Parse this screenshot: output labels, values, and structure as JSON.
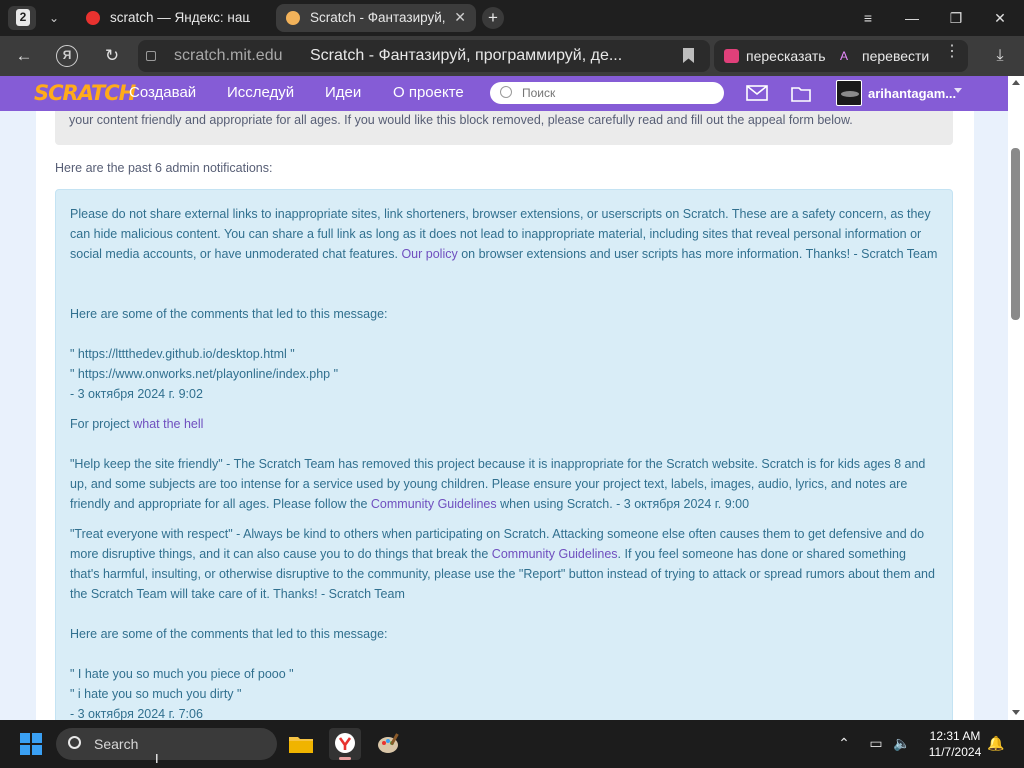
{
  "browser": {
    "tab_count": "2",
    "tabs": [
      {
        "title": "scratch — Яндекс: нашлось",
        "active": false
      },
      {
        "title": "Scratch - Фантазируй, п",
        "active": true
      }
    ],
    "address": {
      "domain": "scratch.mit.edu",
      "page_title": "Scratch - Фантазируй, программируй, де..."
    },
    "actions": {
      "retell": "пересказать",
      "translate": "перевести"
    }
  },
  "scratch_nav": {
    "logo": "SCRATCH",
    "links": [
      "Создавай",
      "Исследуй",
      "Идеи",
      "О проекте"
    ],
    "search_placeholder": "Поиск",
    "username": "arihantagam..."
  },
  "content": {
    "top_alert": "your content friendly and appropriate for all ages. If you would like this block removed, please carefully read and fill out the appeal form below.",
    "past_heading": "Here are the past 6 admin notifications:",
    "notification_1": {
      "t1": "Please do not share external links to inappropriate sites, link shorteners, browser extensions, or userscripts on Scratch. These are a safety concern, as they can hide malicious content. You can share a full link as long as it does not lead to inappropriate material, including sites that reveal personal information or social media accounts, or have unmoderated chat features.",
      "link_policy": "Our policy",
      "t2": "on browser extensions and user scripts has more information. Thanks! - Scratch Team",
      "comments_heading": "Here are some of the comments that led to this message:",
      "comments": [
        "\" https://lttthedev.github.io/desktop.html \"",
        "\" https://www.onworks.net/playonline/index.php \""
      ],
      "date": "- 3 октября 2024 г. 9:02"
    },
    "project_notice": {
      "prefix": "For project",
      "project_link": "what the hell"
    },
    "notification_2": {
      "t1": "\"Help keep the site friendly\" - The Scratch Team has removed this project because it is inappropriate for the Scratch website. Scratch is for kids ages 8 and up, and some subjects are too intense for a service used by young children. Please ensure your project text, labels, images, audio, lyrics, and notes are friendly and appropriate for all ages. Please follow the",
      "link_guidelines": "Community Guidelines",
      "t2": "when using Scratch. - 3 октября 2024 г. 9:00"
    },
    "notification_3": {
      "t1": "\"Treat everyone with respect\" - Always be kind to others when participating on Scratch. Attacking someone else often causes them to get defensive and do more disruptive things, and it can also cause you to do things that break the",
      "link_guidelines": "Community Guidelines",
      "t2": ". If you feel someone has done or shared something that's harmful, insulting, or otherwise disruptive to the community, please use the \"Report\" button instead of trying to attack or spread rumors about them and the Scratch Team will take care of it. Thanks! - Scratch Team",
      "comments_heading": "Here are some of the comments that led to this message:",
      "comments": [
        "\" I hate you so much you piece of pooo \"",
        "\" i hate you so much you dirty \""
      ],
      "date": "- 3 октября 2024 г. 7:06"
    }
  },
  "taskbar": {
    "search_label": "Search",
    "time": "12:31 AM",
    "date": "11/7/2024"
  },
  "colors": {
    "scratch_purple": "#855cd6",
    "info_bg": "#d9edf7",
    "info_text": "#31708f",
    "link": "#6f4fbf"
  }
}
